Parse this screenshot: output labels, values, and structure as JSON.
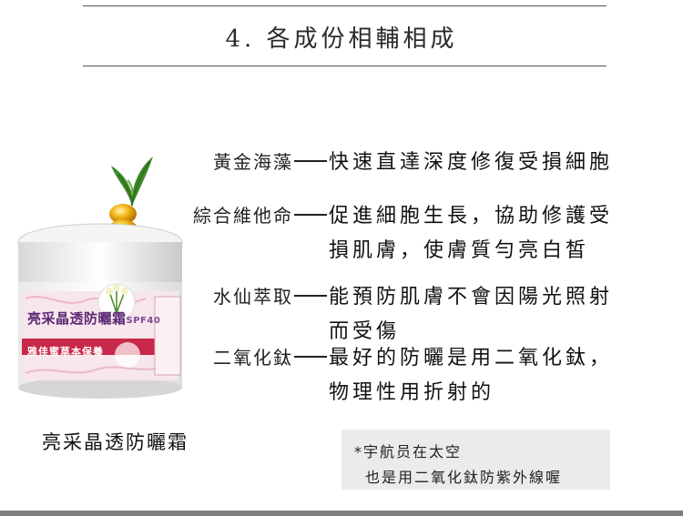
{
  "header": {
    "title": "4. 各成份相輔相成"
  },
  "product": {
    "name": "亮采晶透防曬霜",
    "jar_label": "亮采晶透防曬霜",
    "jar_spf": "SPF40",
    "jar_band": "雅佳蜜草本保養"
  },
  "ingredients": [
    {
      "name": "黃金海藻",
      "desc": [
        "快速直達深度修復受損細胞"
      ]
    },
    {
      "name": "綜合維他命",
      "desc": [
        "促進細胞生長，協助修護受",
        "損肌膚，使膚質勻亮白皙"
      ]
    },
    {
      "name": "水仙萃取",
      "desc": [
        "能預防肌膚不會因陽光照射",
        "而受傷"
      ]
    },
    {
      "name": "二氧化鈦",
      "desc": [
        "最好的防曬是用二氧化鈦，",
        "物理性用折射的"
      ]
    }
  ],
  "note": {
    "line1": "*宇航员在太空",
    "line2": "也是用二氧化鈦防紫外線喔"
  },
  "colors": {
    "brand_purple": "#5c2a74",
    "band_red": "#c8284a",
    "capsule_gold": "#e0a010",
    "leaf_green": "#3f8a2a"
  }
}
